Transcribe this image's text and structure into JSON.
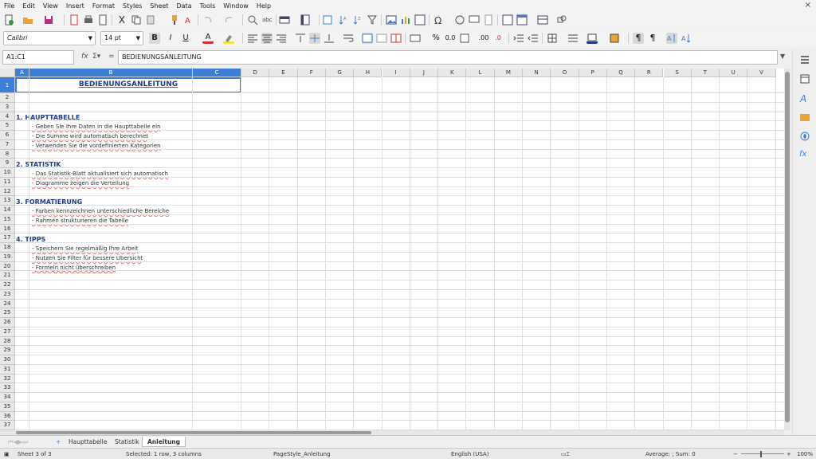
{
  "menu": [
    "File",
    "Edit",
    "View",
    "Insert",
    "Format",
    "Styles",
    "Sheet",
    "Data",
    "Tools",
    "Window",
    "Help"
  ],
  "close_icon": "×",
  "font_name": "Calibri",
  "font_size": "14 pt",
  "name_box": "A1:C1",
  "formula": "BEDIENUNGSANLEITUNG",
  "columns": [
    "A",
    "B",
    "C",
    "D",
    "E",
    "F",
    "G",
    "H",
    "I",
    "J",
    "K",
    "L",
    "M",
    "N",
    "O",
    "P",
    "Q",
    "R",
    "S",
    "T",
    "U",
    "V"
  ],
  "rows": [
    "1",
    "2",
    "3",
    "4",
    "5",
    "6",
    "7",
    "8",
    "9",
    "10",
    "11",
    "12",
    "13",
    "14",
    "15",
    "16",
    "17",
    "18",
    "19",
    "20",
    "21",
    "22",
    "23",
    "24",
    "25",
    "26",
    "27",
    "28",
    "29",
    "30",
    "31",
    "32",
    "33",
    "34",
    "35",
    "36",
    "37"
  ],
  "cells": {
    "title": "BEDIENUNGSANLEITUNG",
    "h1": "1. HAUPTTABELLE",
    "r5": "- Geben Sie Ihre Daten in die Haupttabelle ein",
    "r6": "- Die Summe wird automatisch berechnet",
    "r7": "- Verwenden Sie die vordefinierten Kategorien",
    "h2": "2. STATISTIK",
    "r10": "- Das Statistik-Blatt aktualisiert sich automatisch",
    "r11": "- Diagramme zeigen die Verteilung",
    "h3": "3. FORMATIERUNG",
    "r14": "- Farben kennzeichnen unterschiedliche Bereiche",
    "r15": "- Rahmen strukturieren die Tabelle",
    "h4": "4. TIPPS",
    "r18": "- Speichern Sie regelmäßig Ihre Arbeit",
    "r19": "- Nutzen Sie Filter für bessere Übersicht",
    "r20": "- Formeln nicht überschreiben"
  },
  "tabs": [
    "Haupttabelle",
    "Statistik",
    "Anleitung"
  ],
  "tab_add": "+",
  "status": {
    "sheet": "Sheet 3 of 3",
    "selection": "Selected: 1 row, 3 columns",
    "page_style": "PageStyle_Anleitung",
    "language": "English (USA)",
    "summary": "Average: ; Sum: 0",
    "zoom": "100%"
  },
  "colors": {
    "accent": "#3d7fd6",
    "heading": "#1f3c88"
  }
}
